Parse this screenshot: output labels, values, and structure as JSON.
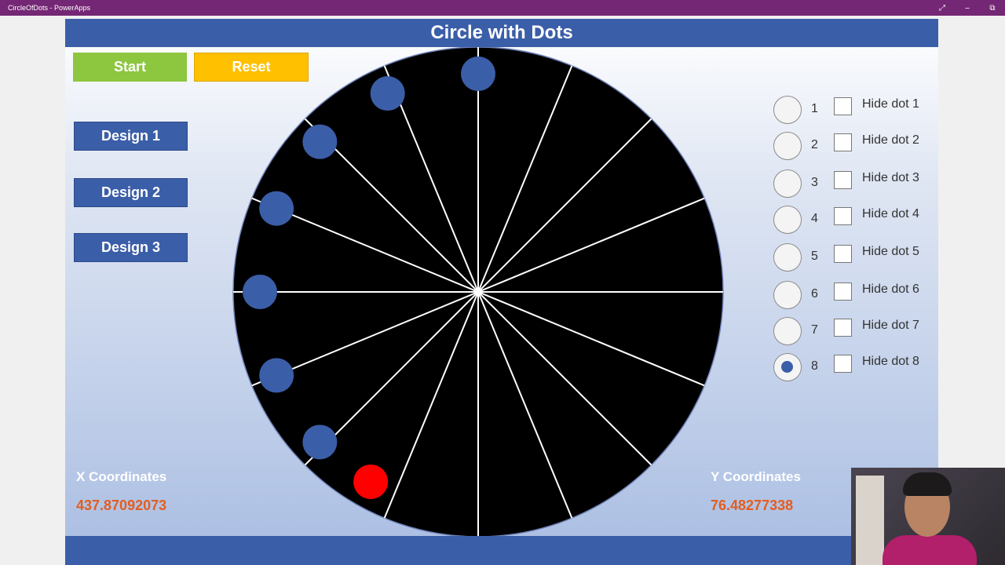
{
  "window": {
    "title": "CircleOfDots - PowerApps",
    "controls": [
      "⤢",
      "–",
      "⧉"
    ]
  },
  "app": {
    "title": "Circle with Dots",
    "buttons": {
      "start": "Start",
      "reset": "Reset",
      "design1": "Design 1",
      "design2": "Design 2",
      "design3": "Design 3"
    },
    "x_coord_label": "X Coordinates",
    "x_coord_value": "437.87092073",
    "y_coord_label": "Y Coordinates",
    "y_coord_value": "76.48277338",
    "options": [
      {
        "number": "1",
        "hide_label": "Hide dot 1",
        "selected": false
      },
      {
        "number": "2",
        "hide_label": "Hide dot 2",
        "selected": false
      },
      {
        "number": "3",
        "hide_label": "Hide dot 3",
        "selected": false
      },
      {
        "number": "4",
        "hide_label": "Hide dot 4",
        "selected": false
      },
      {
        "number": "5",
        "hide_label": "Hide dot 5",
        "selected": false
      },
      {
        "number": "6",
        "hide_label": "Hide dot 6",
        "selected": false
      },
      {
        "number": "7",
        "hide_label": "Hide dot 7",
        "selected": false
      },
      {
        "number": "8",
        "hide_label": "Hide dot 8",
        "selected": true
      }
    ],
    "colors": {
      "brand_blue": "#3b5ea8",
      "start_green": "#8dc63f",
      "reset_yellow": "#ffc000",
      "active_dot": "#ff0000",
      "dot": "#3b5ea8",
      "coord_value": "#e35d1f"
    }
  },
  "circle": {
    "spoke_count": 16,
    "active_dot_index": 0,
    "dot_angles_deg": [
      -60.5,
      -43.5,
      -22.5,
      0,
      22.5,
      43.5,
      65.5,
      90
    ]
  }
}
